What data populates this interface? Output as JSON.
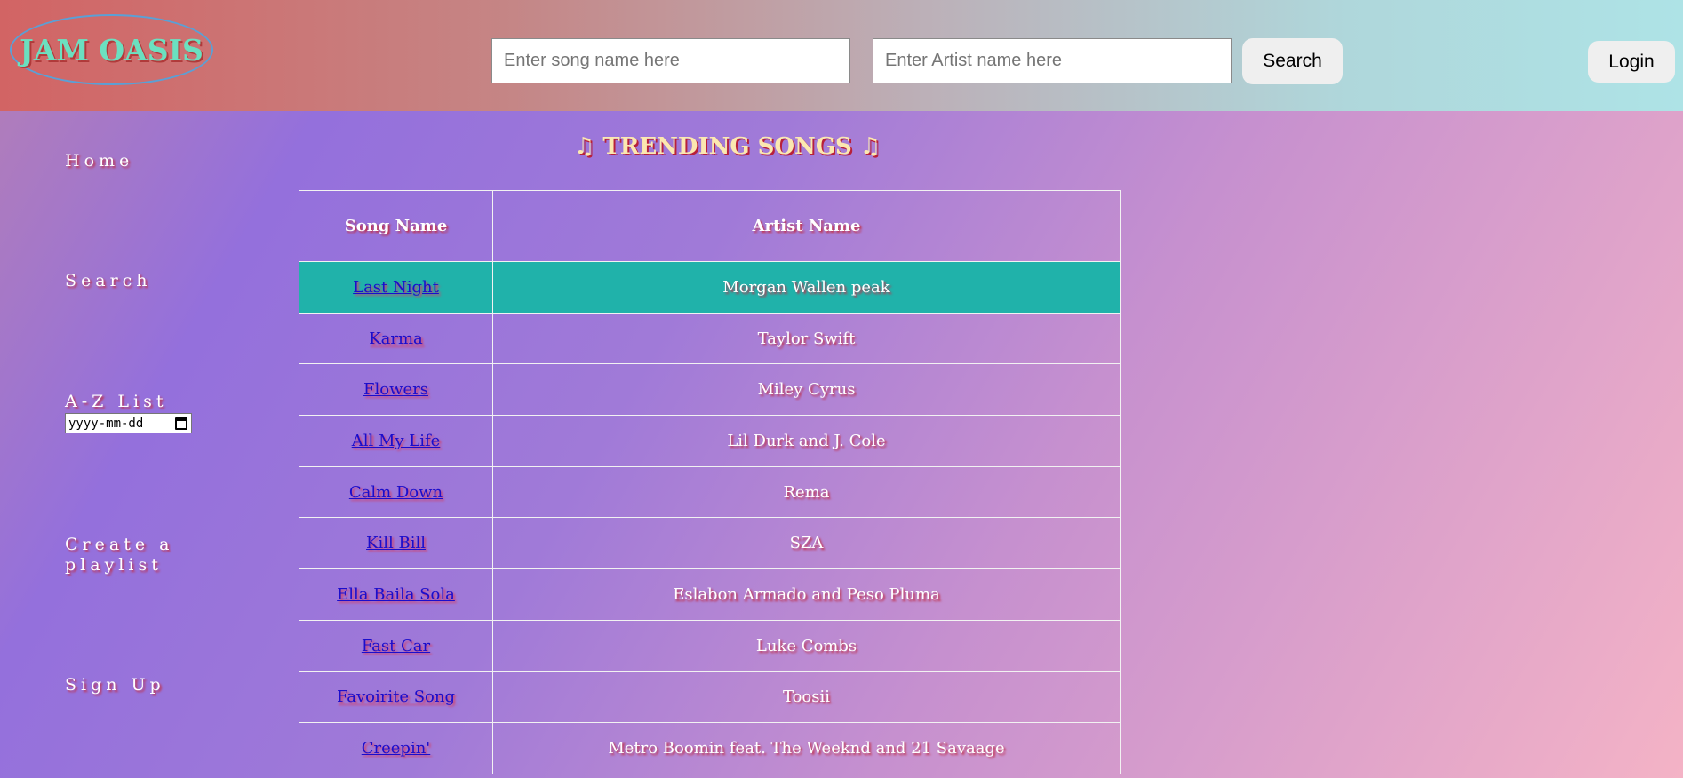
{
  "header": {
    "logo_text": "JAM OASIS",
    "song_placeholder": "Enter song name here",
    "artist_placeholder": "Enter Artist name here",
    "search_label": "Search",
    "login_label": "Login"
  },
  "sidebar": {
    "items": [
      {
        "label": "Home"
      },
      {
        "label": "Search"
      },
      {
        "label": "A-Z List"
      },
      {
        "label": "Create a playlist"
      },
      {
        "label": "Sign Up"
      }
    ],
    "date_placeholder": "yyyy-mm-dd"
  },
  "main": {
    "title": "♫ TRENDING SONGS ♫",
    "columns": [
      "Song Name",
      "Artist Name"
    ],
    "rows": [
      {
        "song": "Last Night",
        "artist": "Morgan Wallen peak"
      },
      {
        "song": "Karma",
        "artist": "Taylor Swift"
      },
      {
        "song": "Flowers",
        "artist": "Miley Cyrus"
      },
      {
        "song": "All My Life",
        "artist": "Lil Durk and J. Cole"
      },
      {
        "song": "Calm Down",
        "artist": "Rema"
      },
      {
        "song": "Kill Bill",
        "artist": "SZA"
      },
      {
        "song": "Ella Baila Sola",
        "artist": "Eslabon Armado and Peso Pluma"
      },
      {
        "song": "Fast Car",
        "artist": "Luke Combs"
      },
      {
        "song": "Favoirite Song",
        "artist": "Toosii"
      },
      {
        "song": "Creepin'",
        "artist": "Metro Boomin feat. The Weeknd and 21 Savaage"
      }
    ]
  },
  "colors": {
    "highlight_row": "#20b2aa",
    "logo_text": "#6be0c0",
    "link": "#1a0dcc"
  }
}
